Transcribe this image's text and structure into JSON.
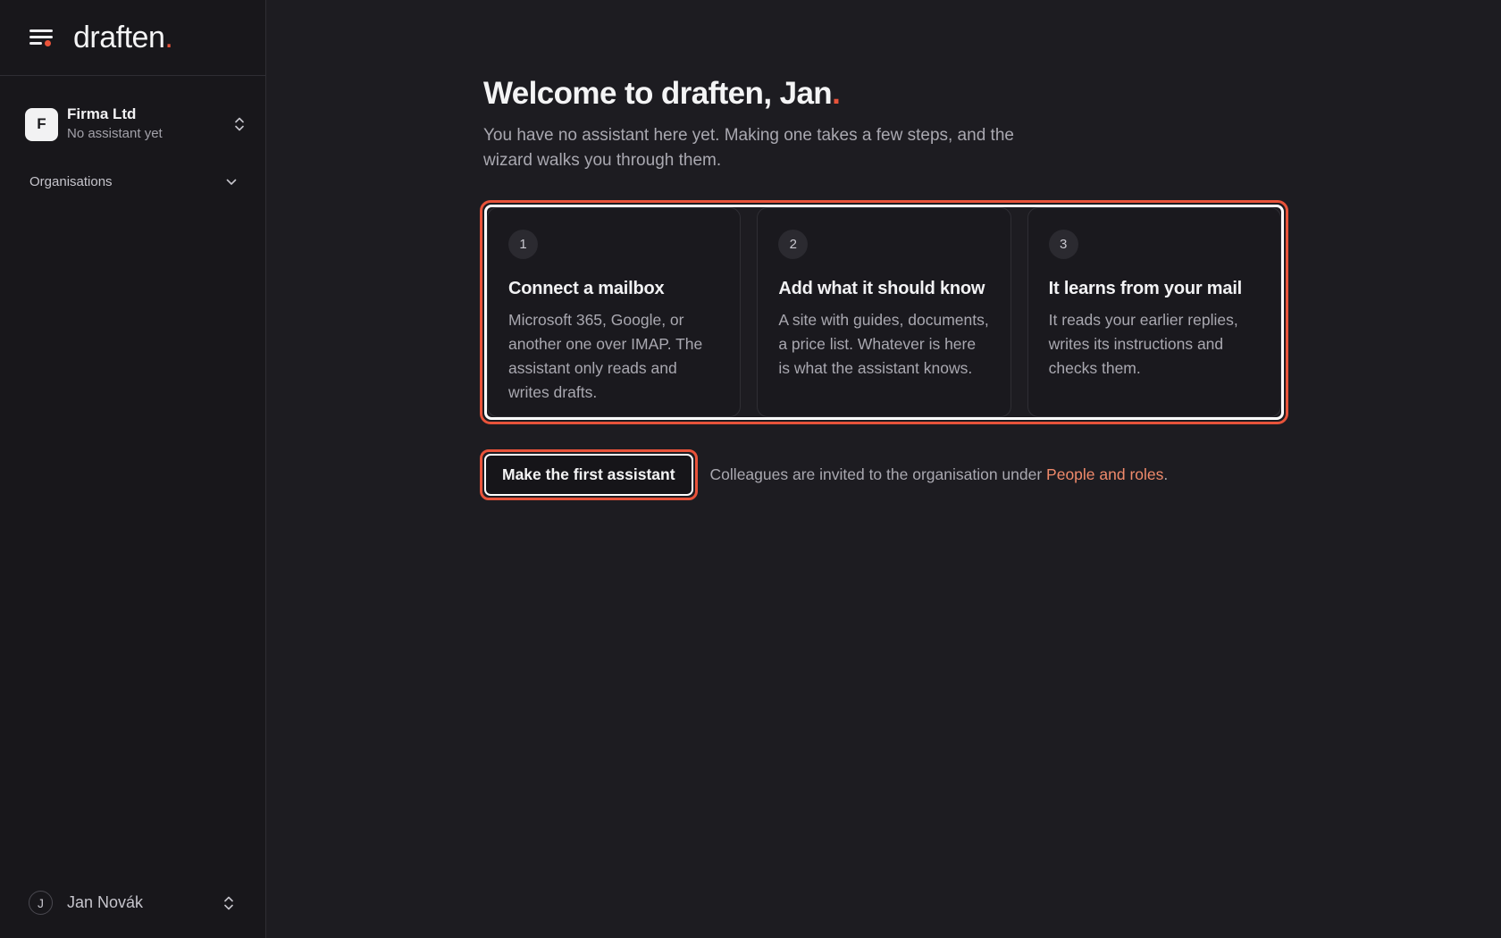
{
  "brand": {
    "name": "draften",
    "dot": ".",
    "accent_color": "#e8533a"
  },
  "header": {
    "menu_icon": "menu-icon"
  },
  "org": {
    "initial": "F",
    "name": "Firma Ltd",
    "status": "No assistant yet",
    "switch_icon": "chevron-updown-icon"
  },
  "sidebar": {
    "section_label": "Organisations",
    "section_icon": "chevron-down-icon"
  },
  "user": {
    "initial": "J",
    "name": "Jan Novák",
    "switch_icon": "chevron-updown-icon"
  },
  "main": {
    "title": "Welcome to draften, Jan",
    "title_dot": ".",
    "subtitle": "You have no assistant here yet. Making one takes a few steps, and the wizard walks you through them.",
    "steps": [
      {
        "number": "1",
        "title": "Connect a mailbox",
        "description": "Microsoft 365, Google, or another one over IMAP. The assistant only reads and writes drafts."
      },
      {
        "number": "2",
        "title": "Add what it should know",
        "description": "A site with guides, documents, a price list. Whatever is here is what the assistant knows."
      },
      {
        "number": "3",
        "title": "It learns from your mail",
        "description": "It reads your earlier replies, writes its instructions and checks them."
      }
    ],
    "cta_label": "Make the first assistant",
    "note_text": "Colleagues are invited to the organisation under ",
    "note_link": "People and roles",
    "note_end": "."
  }
}
